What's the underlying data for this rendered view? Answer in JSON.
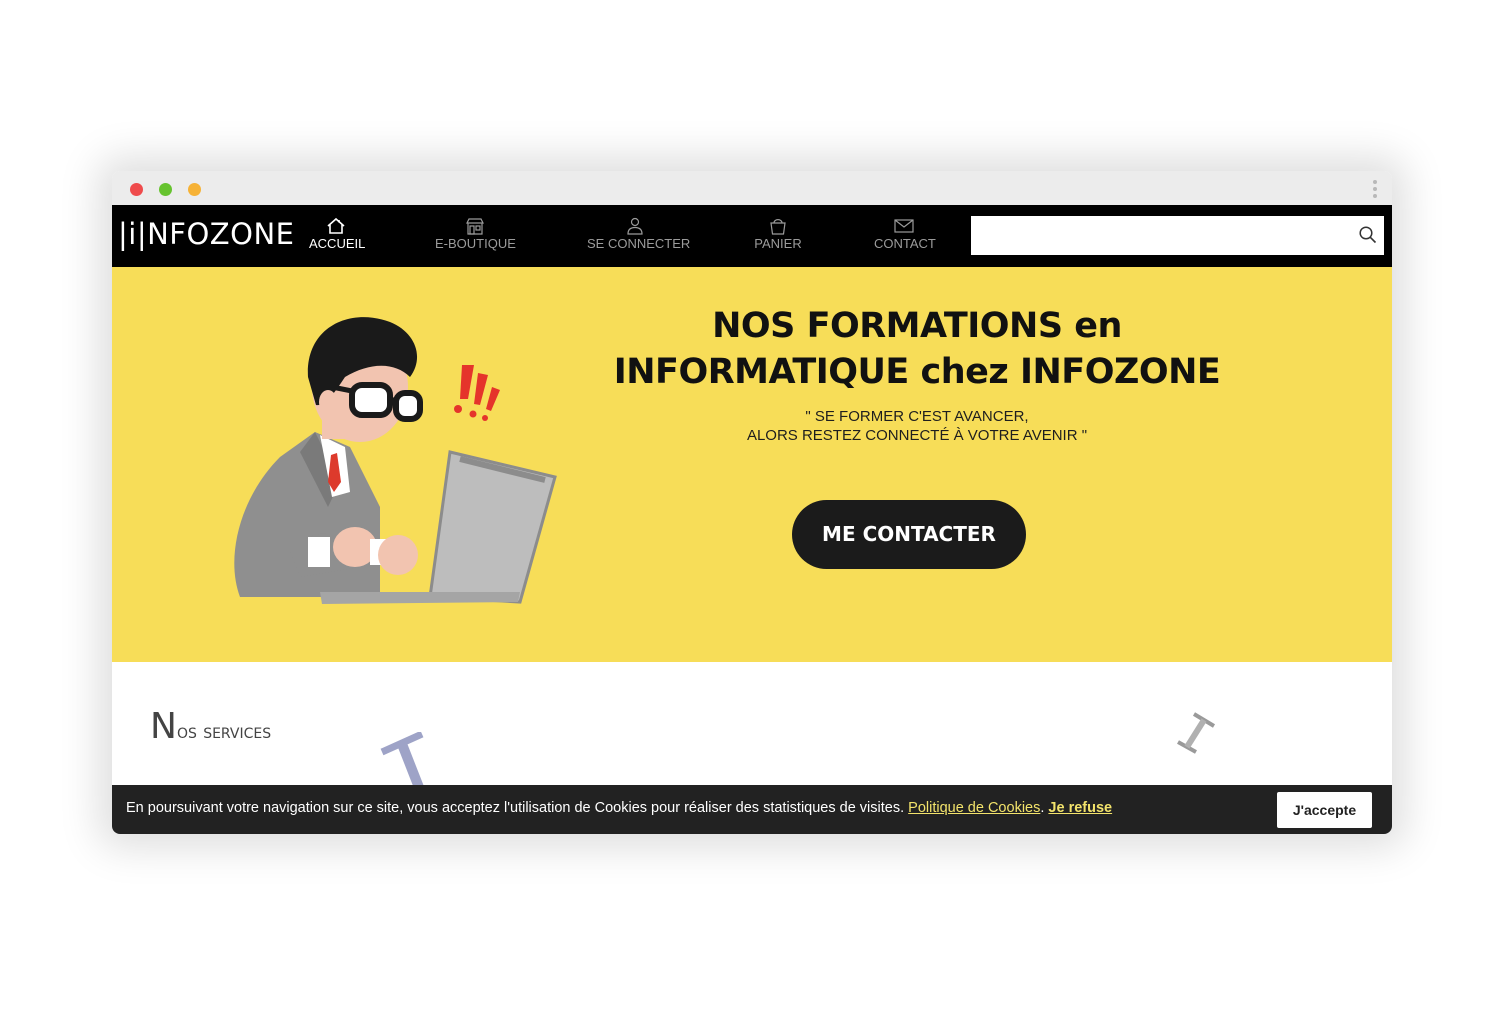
{
  "browser": {
    "window_controls": [
      "close",
      "minimize",
      "maximize"
    ]
  },
  "navbar": {
    "logo": "|i|NFOZONE",
    "items": [
      {
        "label": "ACCUEIL",
        "icon": "home-icon",
        "active": true
      },
      {
        "label": "E-BOUTIQUE",
        "icon": "store-icon",
        "active": false
      },
      {
        "label": "SE CONNECTER",
        "icon": "user-icon",
        "active": false
      },
      {
        "label": "PANIER",
        "icon": "basket-icon",
        "active": false
      },
      {
        "label": "CONTACT",
        "icon": "envelope-icon",
        "active": false
      }
    ],
    "search": {
      "value": "",
      "placeholder": "",
      "icon": "search-icon"
    }
  },
  "hero": {
    "title_line1": "NOS FORMATIONS en",
    "title_line2": "INFORMATIQUE chez INFOZONE",
    "quote_line1": "\" SE FORMER C'EST AVANCER,",
    "quote_line2": "ALORS RESTEZ CONNECTÉ À VOTRE AVENIR \"",
    "cta_label": "ME CONTACTER",
    "background": "#f7dd58"
  },
  "services": {
    "title_initial": "N",
    "title_rest": "os services"
  },
  "cookie": {
    "text": "En poursuivant votre navigation sur ce site, vous acceptez l'utilisation de Cookies pour réaliser des statistiques de visites.",
    "policy_link": "Politique de Cookies",
    "separator": ".",
    "refuse_link": "Je refuse",
    "accept_label": "J'accepte",
    "link_color": "#f3e36b"
  }
}
